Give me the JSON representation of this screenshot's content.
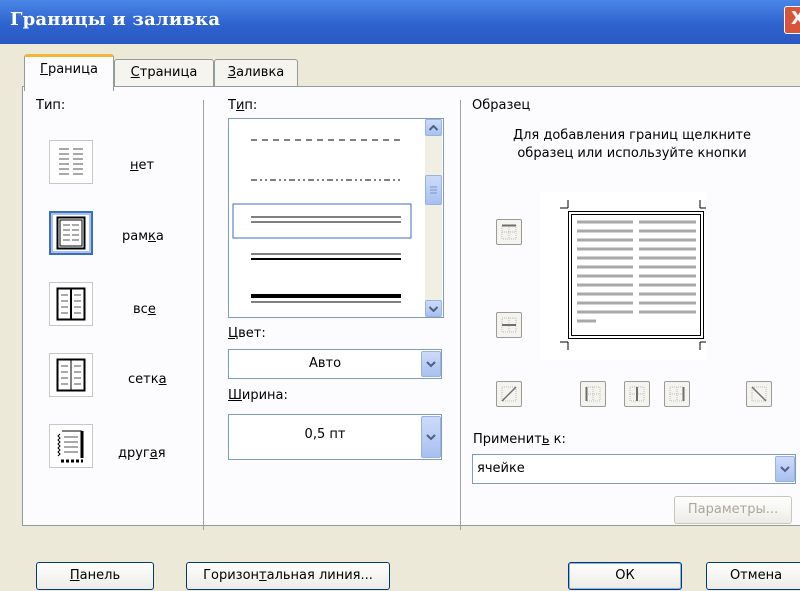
{
  "window": {
    "title": "Границы и заливка",
    "close_glyph": "X"
  },
  "tabs": [
    {
      "label_html": "<span class=\"u\">Г</span>раница",
      "active": true
    },
    {
      "label_html": "<span class=\"u\">С</span>траница",
      "active": false
    },
    {
      "label_html": "<span class=\"u\">З</span>аливка",
      "active": false
    }
  ],
  "type_section": {
    "label": "Тип:",
    "items": [
      {
        "label_html": "<span class=\"u\">н</span>ет",
        "icon": "border-none-icon",
        "selected": false
      },
      {
        "label_html": "рам<span class=\"u\">к</span>а",
        "icon": "border-box-icon",
        "selected": true
      },
      {
        "label_html": "вс<span class=\"u\">е</span>",
        "icon": "border-all-icon",
        "selected": false
      },
      {
        "label_html": "сетк<span class=\"u\">а</span>",
        "icon": "border-grid-icon",
        "selected": false
      },
      {
        "label_html": "друг<span class=\"u\">а</span>я",
        "icon": "border-custom-icon",
        "selected": false
      }
    ]
  },
  "style_section": {
    "label_html": "Т<span class=\"u\">и</span>п:",
    "selected_style": "double",
    "color_label_html": "<span class=\"u\">Ц</span>вет:",
    "color_value": "Авто",
    "width_label_html": "<span class=\"u\">Ш</span>ирина:",
    "width_value": "0,5 пт"
  },
  "preview_section": {
    "label": "Образец",
    "hint_line1": "Для добавления границ щелкните",
    "hint_line2": "образец или используйте кнопки",
    "apply_label_html": "Применит<span class=\"u\">ь</span> к:",
    "apply_value": "ячейке",
    "params_button": "Параметры..."
  },
  "buttons": {
    "panel_html": "<span class=\"u\">П</span>анель",
    "hline_html": "Горизон<span class=\"u\">т</span>альная линия...",
    "ok": "ОК",
    "cancel": "Отмена"
  },
  "colors": {
    "accent": "#3c6fc4",
    "tab_highlight": "#f3b53c",
    "title_bar": "#2f63cf"
  }
}
